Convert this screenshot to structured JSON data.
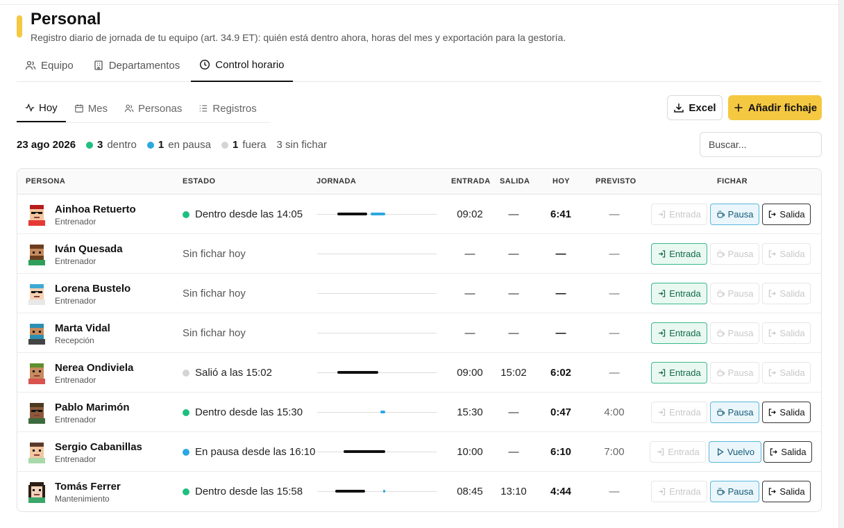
{
  "page": {
    "title": "Personal",
    "subtitle": "Registro diario de jornada de tu equipo (art. 34.9 ET): quién está dentro ahora, horas del mes y exportación para la gestoría."
  },
  "main_tabs": [
    {
      "label": "Equipo",
      "icon": "users-icon",
      "active": false
    },
    {
      "label": "Departamentos",
      "icon": "building-icon",
      "active": false
    },
    {
      "label": "Control horario",
      "icon": "clock-icon",
      "active": true
    }
  ],
  "sub_tabs": [
    {
      "label": "Hoy",
      "icon": "activity-icon",
      "active": true
    },
    {
      "label": "Mes",
      "icon": "calendar-icon",
      "active": false
    },
    {
      "label": "Personas",
      "icon": "users-icon",
      "active": false
    },
    {
      "label": "Registros",
      "icon": "list-icon",
      "active": false
    }
  ],
  "actions": {
    "excel_label": "Excel",
    "add_label": "Añadir fichaje"
  },
  "summary": {
    "date": "23 ago 2026",
    "inside_count": "3",
    "inside_label": "dentro",
    "pause_count": "1",
    "pause_label": "en pausa",
    "out_count": "1",
    "out_label": "fuera",
    "unclocked": "3 sin fichar"
  },
  "search": {
    "placeholder": "Buscar..."
  },
  "colors": {
    "accent": "#f5c842",
    "inside": "#1fbf7f",
    "pause": "#2aa8e0",
    "out": "#d4d4d4",
    "work_bar": "#111111",
    "pause_bar": "#2aa8e0"
  },
  "columns": {
    "persona": "PERSONA",
    "estado": "ESTADO",
    "jornada": "JORNADA",
    "entrada": "ENTRADA",
    "salida": "SALIDA",
    "hoy": "HOY",
    "previsto": "PREVISTO",
    "fichar": "FICHAR"
  },
  "buttons": {
    "entrada": "Entrada",
    "pausa": "Pausa",
    "vuelvo": "Vuelvo",
    "salida": "Salida"
  },
  "rows": [
    {
      "name": "Ainhoa Retuerto",
      "role": "Entrenador",
      "status": "Dentro desde las 14:05",
      "status_color": "inside",
      "entrada": "09:02",
      "salida": "—",
      "hoy": "6:41",
      "previsto": "—",
      "segments": [
        {
          "type": "work",
          "start": 0.17,
          "end": 0.42
        },
        {
          "type": "pause",
          "start": 0.45,
          "end": 0.57
        }
      ],
      "btn_entrada": "disabled",
      "btn_mid": "pausa",
      "btn_mid_state": "active",
      "btn_salida": "active"
    },
    {
      "name": "Iván Quesada",
      "role": "Entrenador",
      "status": "Sin fichar hoy",
      "status_color": "",
      "entrada": "—",
      "salida": "—",
      "hoy": "—",
      "previsto": "—",
      "segments": [],
      "btn_entrada": "active",
      "btn_mid": "pausa",
      "btn_mid_state": "disabled",
      "btn_salida": "disabled"
    },
    {
      "name": "Lorena Bustelo",
      "role": "Entrenador",
      "status": "Sin fichar hoy",
      "status_color": "",
      "entrada": "—",
      "salida": "—",
      "hoy": "—",
      "previsto": "—",
      "segments": [],
      "btn_entrada": "active",
      "btn_mid": "pausa",
      "btn_mid_state": "disabled",
      "btn_salida": "disabled"
    },
    {
      "name": "Marta Vidal",
      "role": "Recepción",
      "status": "Sin fichar hoy",
      "status_color": "",
      "entrada": "—",
      "salida": "—",
      "hoy": "—",
      "previsto": "—",
      "segments": [],
      "btn_entrada": "active",
      "btn_mid": "pausa",
      "btn_mid_state": "disabled",
      "btn_salida": "disabled"
    },
    {
      "name": "Nerea Ondiviela",
      "role": "Entrenador",
      "status": "Salió a las 15:02",
      "status_color": "out",
      "entrada": "09:00",
      "salida": "15:02",
      "hoy": "6:02",
      "previsto": "—",
      "segments": [
        {
          "type": "work",
          "start": 0.17,
          "end": 0.51
        }
      ],
      "btn_entrada": "active",
      "btn_mid": "pausa",
      "btn_mid_state": "disabled",
      "btn_salida": "disabled"
    },
    {
      "name": "Pablo Marimón",
      "role": "Entrenador",
      "status": "Dentro desde las 15:30",
      "status_color": "inside",
      "entrada": "15:30",
      "salida": "—",
      "hoy": "0:47",
      "previsto": "4:00",
      "segments": [
        {
          "type": "pause",
          "start": 0.53,
          "end": 0.57
        }
      ],
      "btn_entrada": "disabled",
      "btn_mid": "pausa",
      "btn_mid_state": "active",
      "btn_salida": "active"
    },
    {
      "name": "Sergio Cabanillas",
      "role": "Entrenador",
      "status": "En pausa desde las 16:10",
      "status_color": "pause",
      "entrada": "10:00",
      "salida": "—",
      "hoy": "6:10",
      "previsto": "7:00",
      "segments": [
        {
          "type": "work",
          "start": 0.22,
          "end": 0.57
        }
      ],
      "btn_entrada": "disabled",
      "btn_mid": "vuelvo",
      "btn_mid_state": "active",
      "btn_salida": "active"
    },
    {
      "name": "Tomás Ferrer",
      "role": "Mantenimiento",
      "status": "Dentro desde las 15:58",
      "status_color": "inside",
      "entrada": "08:45",
      "salida": "13:10",
      "hoy": "4:44",
      "previsto": "—",
      "segments": [
        {
          "type": "work",
          "start": 0.15,
          "end": 0.4
        },
        {
          "type": "pause",
          "start": 0.555,
          "end": 0.57
        }
      ],
      "btn_entrada": "disabled",
      "btn_mid": "pausa",
      "btn_mid_state": "active",
      "btn_salida": "active"
    }
  ]
}
